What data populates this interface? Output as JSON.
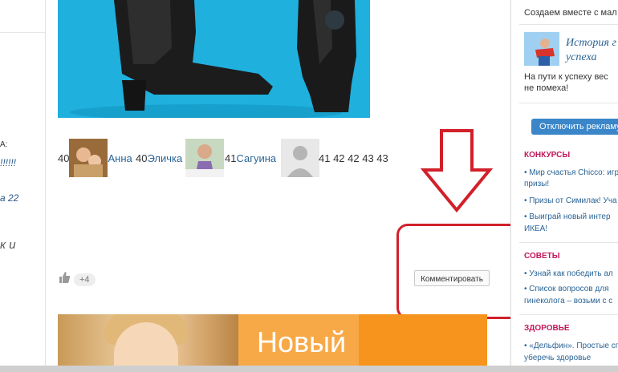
{
  "left_column": {
    "fragments": [
      "А:",
      "!!!!!!",
      "а 22",
      "к и"
    ]
  },
  "likers": [
    {
      "num_before": "40",
      "name": "Анна"
    },
    {
      "num_before": "40",
      "name": "Эличка"
    },
    {
      "num_before": "41",
      "name": "Сагуина"
    }
  ],
  "trailing_numbers": "41 42 42 43 43",
  "like_count": "+4",
  "comment_button": "Комментировать",
  "banner": {
    "text": "Новый"
  },
  "sidebar": {
    "top_text": "Создаем вместе с мал",
    "story_title_line1": "История г",
    "story_title_line2": "успеха",
    "story_sub_line1": "На пути к успеху вес",
    "story_sub_line2": "не помеха!",
    "ads_button": "Отключить рекламу",
    "sections": [
      {
        "title": "КОНКУРСЫ",
        "links": [
          "• Мир счастья Chicco: игр",
          "призы!",
          "• Призы от Симилак! Уча",
          "• Выиграй новый интер",
          "ИКЕА!"
        ]
      },
      {
        "title": "СОВЕТЫ",
        "links": [
          "• Узнай как победить ал",
          "• Список вопросов для",
          "гинеколога – возьми с с"
        ]
      },
      {
        "title": "ЗДОРОВЬЕ",
        "links": [
          "• «Дельфин». Простые сп",
          "уберечь здоровье"
        ]
      }
    ]
  }
}
